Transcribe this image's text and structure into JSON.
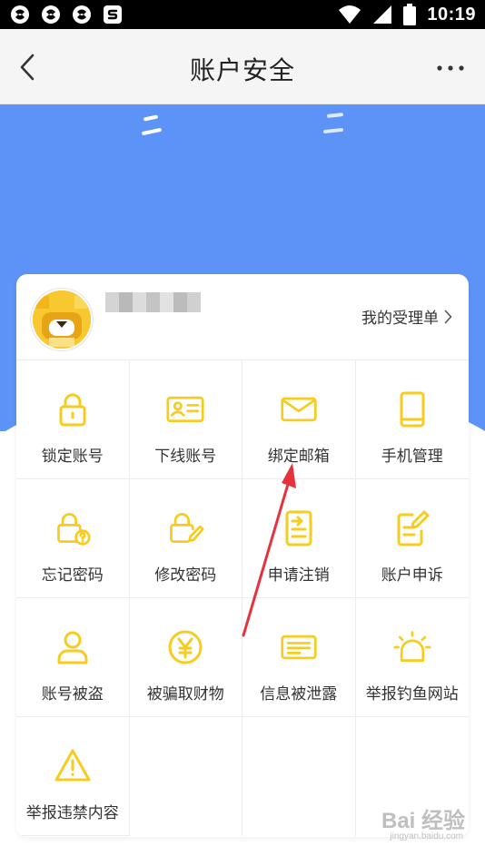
{
  "status_bar": {
    "time": "10:19",
    "notification_icons": [
      "app-notification-icon",
      "app-notification-icon",
      "app-notification-icon",
      "sogou-s-icon"
    ],
    "status_icons": [
      "wifi-icon",
      "signal-icon",
      "battery-icon"
    ]
  },
  "header": {
    "title": "账户安全",
    "back_icon": "chevron-left-icon",
    "more_icon": "more-dots-icon"
  },
  "colors": {
    "hero_blue": "#5d93f7",
    "icon_yellow": "#f7cc1e",
    "annotation_red": "#e8323b"
  },
  "account": {
    "username": "",
    "tickets_link": "我的受理单"
  },
  "menu": {
    "items": [
      {
        "label": "锁定账号",
        "icon": "lock-icon"
      },
      {
        "label": "下线账号",
        "icon": "id-card-icon"
      },
      {
        "label": "绑定邮箱",
        "icon": "envelope-icon"
      },
      {
        "label": "手机管理",
        "icon": "phone-icon"
      },
      {
        "label": "忘记密码",
        "icon": "lock-question-icon"
      },
      {
        "label": "修改密码",
        "icon": "lock-edit-icon"
      },
      {
        "label": "申请注销",
        "icon": "document-arrow-icon"
      },
      {
        "label": "账户申诉",
        "icon": "document-edit-icon"
      },
      {
        "label": "账号被盗",
        "icon": "user-icon"
      },
      {
        "label": "被骗取财物",
        "icon": "yen-coin-icon"
      },
      {
        "label": "信息被泄露",
        "icon": "message-lines-icon"
      },
      {
        "label": "举报钓鱼网站",
        "icon": "alarm-light-icon"
      },
      {
        "label": "举报违禁内容",
        "icon": "warning-triangle-icon"
      }
    ]
  },
  "watermark": {
    "brand": "Bai 经验",
    "sub": "jingyan.baidu.com"
  }
}
